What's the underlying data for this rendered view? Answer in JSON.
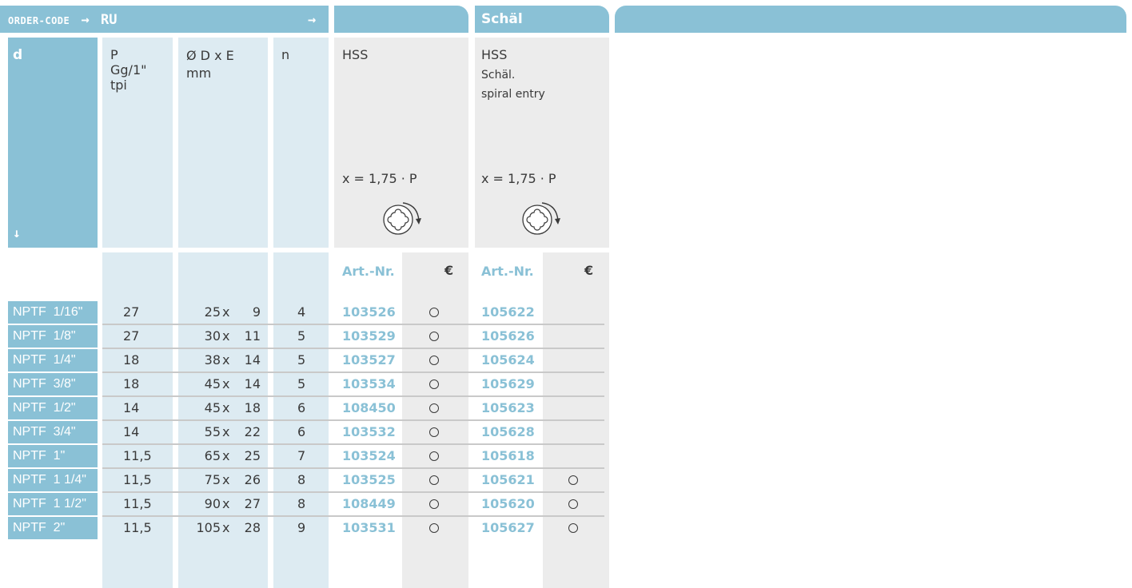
{
  "header": {
    "order_code_label": "ORDER-CODE",
    "order_arrow": "→",
    "order_code_value": "RU",
    "next_arrow": "→",
    "group2_title": "Schäl"
  },
  "columns": {
    "d": "d",
    "d_arrow": "↓",
    "p_line1": "P",
    "p_line2": "Gg/1\"",
    "p_line3": "tpi",
    "dim_line1": "Ø D x E",
    "dim_line2": "mm",
    "n": "n",
    "hss1_title": "HSS",
    "hss2_title": "HSS",
    "hss2_sub1": "Schäl.",
    "hss2_sub2": "spiral entry",
    "formula1": "x = 1,75 · P",
    "formula2": "x = 1,75 · P",
    "art_label_1": "Art.-Nr.",
    "euro_1": "€",
    "art_label_2": "Art.-Nr.",
    "euro_2": "€"
  },
  "rows": [
    {
      "d": "NPTF  1/16\"",
      "p": "27",
      "d1": "25",
      "e": "9",
      "n": "4",
      "art1": "103526",
      "avail1": true,
      "art2": "105622",
      "avail2": false
    },
    {
      "d": "NPTF  1/8\"",
      "p": "27",
      "d1": "30",
      "e": "11",
      "n": "5",
      "art1": "103529",
      "avail1": true,
      "art2": "105626",
      "avail2": false
    },
    {
      "d": "NPTF  1/4\"",
      "p": "18",
      "d1": "38",
      "e": "14",
      "n": "5",
      "art1": "103527",
      "avail1": true,
      "art2": "105624",
      "avail2": false
    },
    {
      "d": "NPTF  3/8\"",
      "p": "18",
      "d1": "45",
      "e": "14",
      "n": "5",
      "art1": "103534",
      "avail1": true,
      "art2": "105629",
      "avail2": false
    },
    {
      "d": "NPTF  1/2\"",
      "p": "14",
      "d1": "45",
      "e": "18",
      "n": "6",
      "art1": "108450",
      "avail1": true,
      "art2": "105623",
      "avail2": false
    },
    {
      "d": "NPTF  3/4\"",
      "p": "14",
      "d1": "55",
      "e": "22",
      "n": "6",
      "art1": "103532",
      "avail1": true,
      "art2": "105628",
      "avail2": false
    },
    {
      "d": "NPTF  1\"",
      "p": "11,5",
      "d1": "65",
      "e": "25",
      "n": "7",
      "art1": "103524",
      "avail1": true,
      "art2": "105618",
      "avail2": false
    },
    {
      "d": "NPTF  1 1/4\"",
      "p": "11,5",
      "d1": "75",
      "e": "26",
      "n": "8",
      "art1": "103525",
      "avail1": true,
      "art2": "105621",
      "avail2": true
    },
    {
      "d": "NPTF  1 1/2\"",
      "p": "11,5",
      "d1": "90",
      "e": "27",
      "n": "8",
      "art1": "108449",
      "avail1": true,
      "art2": "105620",
      "avail2": true
    },
    {
      "d": "NPTF  2\"",
      "p": "11,5",
      "d1": "105",
      "e": "28",
      "n": "9",
      "art1": "103531",
      "avail1": true,
      "art2": "105627",
      "avail2": true
    }
  ],
  "dim_separator": "x",
  "colors": {
    "accent": "#8ac1d6",
    "light": "#ddebf2",
    "grey": "#ececec",
    "text": "#3a3a3a"
  }
}
